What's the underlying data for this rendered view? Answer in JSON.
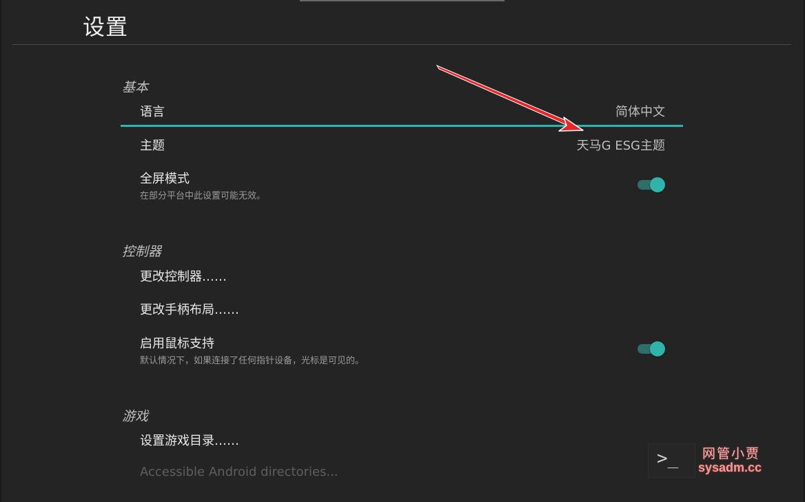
{
  "page": {
    "title": "设置"
  },
  "sections": {
    "basic": {
      "header": "基本",
      "language": {
        "label": "语言",
        "value": "简体中文"
      },
      "theme": {
        "label": "主题",
        "value": "天马G ESG主题"
      },
      "fullscreen": {
        "label": "全屏模式",
        "sub": "在部分平台中此设置可能无效。",
        "enabled": true
      }
    },
    "controllers": {
      "header": "控制器",
      "change_controller": {
        "label": "更改控制器……"
      },
      "change_layout": {
        "label": "更改手柄布局……"
      },
      "mouse": {
        "label": "启用鼠标支持",
        "sub": "默认情况下，如果连接了任何指针设备，光标是可见的。",
        "enabled": true
      }
    },
    "games": {
      "header": "游戏",
      "set_dir": {
        "label": "设置游戏目录……"
      },
      "android_dirs": {
        "label": "Accessible Android directories..."
      }
    }
  },
  "overlay": {
    "terminal_glyph": ">_",
    "watermark_top": "网管小贾",
    "watermark_bottom": "sysadm.cc"
  },
  "colors": {
    "accent": "#30b2b2",
    "annotation_arrow": "#e8262a",
    "background": "#242424"
  },
  "icons": {
    "terminal": "terminal-icon",
    "annotation": "red-arrow"
  }
}
